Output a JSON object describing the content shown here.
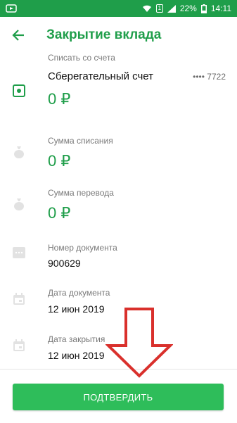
{
  "status_bar": {
    "battery": "22%",
    "time": "14:11",
    "sim": "1",
    "icons": [
      "notification-icon",
      "wifi-icon",
      "sim-icon",
      "signal-icon",
      "battery-icon"
    ]
  },
  "header": {
    "title": "Закрытие вклада",
    "back_icon": "arrow-left-icon"
  },
  "fields": {
    "source": {
      "label": "Списать со счета",
      "account_name": "Сберегательный счет",
      "account_mask": "•••• 7722",
      "balance": "0 ₽"
    },
    "debit_amount": {
      "label": "Сумма списания",
      "value": "0 ₽"
    },
    "transfer_amount": {
      "label": "Сумма перевода",
      "value": "0 ₽"
    },
    "document_number": {
      "label": "Номер документа",
      "value": "900629"
    },
    "document_date": {
      "label": "Дата документа",
      "value": "12 июн 2019"
    },
    "closing_date": {
      "label": "Дата закрытия",
      "value": "12 июн 2019"
    }
  },
  "footer": {
    "confirm_label": "ПОДТВЕРДИТЬ"
  },
  "colors": {
    "brand": "#1f9e4a",
    "button": "#2ebd5a",
    "annotation_arrow": "#d9302c"
  }
}
